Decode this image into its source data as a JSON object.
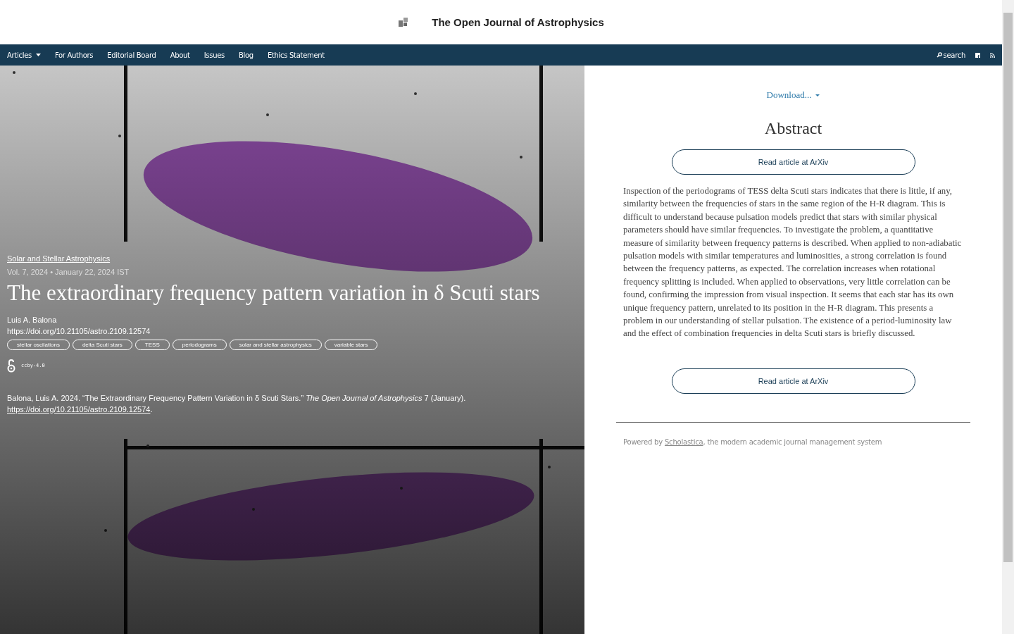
{
  "header": {
    "title": "The Open Journal of Astrophysics"
  },
  "nav": {
    "items": [
      {
        "label": "Articles",
        "dropdown": true
      },
      {
        "label": "For Authors",
        "dropdown": false
      },
      {
        "label": "Editorial Board",
        "dropdown": false
      },
      {
        "label": "About",
        "dropdown": false
      },
      {
        "label": "Issues",
        "dropdown": false
      },
      {
        "label": "Blog",
        "dropdown": false
      },
      {
        "label": "Ethics Statement",
        "dropdown": false
      }
    ],
    "search": "search"
  },
  "article": {
    "section": "Solar and Stellar Astrophysics",
    "meta": "Vol. 7, 2024 • January 22, 2024 IST",
    "title": "The extraordinary frequency pattern variation in δ Scuti stars",
    "author": "Luis A. Balona",
    "doi": "https://doi.org/10.21105/astro.2109.12574",
    "keywords": [
      "stellar oscilations",
      "delta Scuti stars",
      "TESS",
      "periodograms",
      "solar and stellar astrophysics",
      "variable stars"
    ],
    "license": "ccby-4.0",
    "citation": "Balona, Luis A. 2024. “The Extraordinary Frequency Pattern Variation in δ Scuti Stars.” *The Open Journal of Astrophysics* 7 (January).",
    "citation_link": "https://doi.org/10.21105/astro.2109.12574",
    "citation_end": "."
  },
  "side": {
    "download": "Download...",
    "heading": "Abstract",
    "button_top": "Read article at ArXiv",
    "abstract": "Inspection of the periodograms of TESS delta Scuti stars indicates that there is little, if any, similarity between the frequencies of stars in the same region of the H-R diagram. This is difficult to understand because pulsation models predict that stars with similar physical parameters should have similar frequencies. To investigate the problem, a quantitative measure of similarity between frequency patterns is described. When applied to non-adiabatic pulsation models with similar temperatures and luminosities, a strong correlation is found between the frequency patterns, as expected. The correlation increases when rotational frequency splitting is included. When applied to observations, very little correlation can be found, confirming the impression from visual inspection. It seems that each star has its own unique frequency pattern, unrelated to its position in the H-R diagram. This presents a problem in our understanding of stellar pulsation. The existence of a period-luminosity law and the effect of combination frequencies in delta Scuti stars is briefly discussed.",
    "button_bottom": "Read article at ArXiv",
    "powered_prefix": "Powered by",
    "powered_link": "Scholastica",
    "powered_suffix": ", the modern academic journal management system"
  }
}
